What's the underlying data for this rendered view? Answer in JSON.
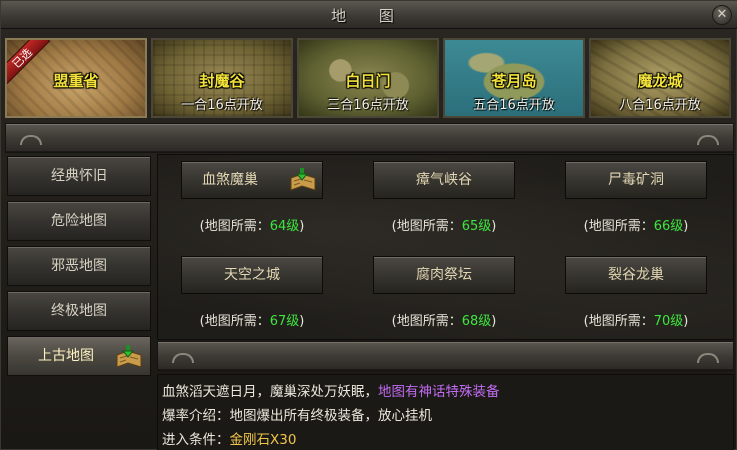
{
  "window": {
    "title": "地 图",
    "close_symbol": "✕"
  },
  "regions": [
    {
      "name": "盟重省",
      "open_text": "",
      "badge": "已选",
      "selected": true
    },
    {
      "name": "封魔谷",
      "open_text": "一合16点开放"
    },
    {
      "name": "白日门",
      "open_text": "三合16点开放"
    },
    {
      "name": "苍月岛",
      "open_text": "五合16点开放"
    },
    {
      "name": "魔龙城",
      "open_text": "八合16点开放"
    }
  ],
  "sidebar": {
    "items": [
      {
        "label": "经典怀旧"
      },
      {
        "label": "危险地图"
      },
      {
        "label": "邪恶地图"
      },
      {
        "label": "终极地图"
      },
      {
        "label": "上古地图",
        "active": true,
        "icon": "map-scroll-icon"
      }
    ]
  },
  "maps": [
    {
      "name": "血煞魔巢",
      "req_prefix": "(地图所需：",
      "level": "64级",
      "req_suffix": ")",
      "icon": "map-scroll-icon"
    },
    {
      "name": "瘴气峡谷",
      "req_prefix": "(地图所需：",
      "level": "65级",
      "req_suffix": ")"
    },
    {
      "name": "尸毒矿洞",
      "req_prefix": "(地图所需：",
      "level": "66级",
      "req_suffix": ")"
    },
    {
      "name": "天空之城",
      "req_prefix": "(地图所需：",
      "level": "67级",
      "req_suffix": ")"
    },
    {
      "name": "腐肉祭坛",
      "req_prefix": "(地图所需：",
      "level": "68级",
      "req_suffix": ")"
    },
    {
      "name": "裂谷龙巢",
      "req_prefix": "(地图所需：",
      "level": "70级",
      "req_suffix": ")"
    }
  ],
  "description": {
    "line1_text": "血煞滔天遮日月，魔巢深处万妖眠，",
    "line1_highlight": "地图有神话特殊装备",
    "line2_text": "爆率介绍：地图爆出所有终极装备，放心挂机",
    "line3_label": "进入条件：",
    "line3_value": "金刚石X30"
  },
  "colors": {
    "level_green": "#3ee63e",
    "highlight_purple": "#c26cf2",
    "cost_gold": "#f0c64a",
    "region_name_yellow": "#f2e23a",
    "badge_red": "#c02826"
  }
}
